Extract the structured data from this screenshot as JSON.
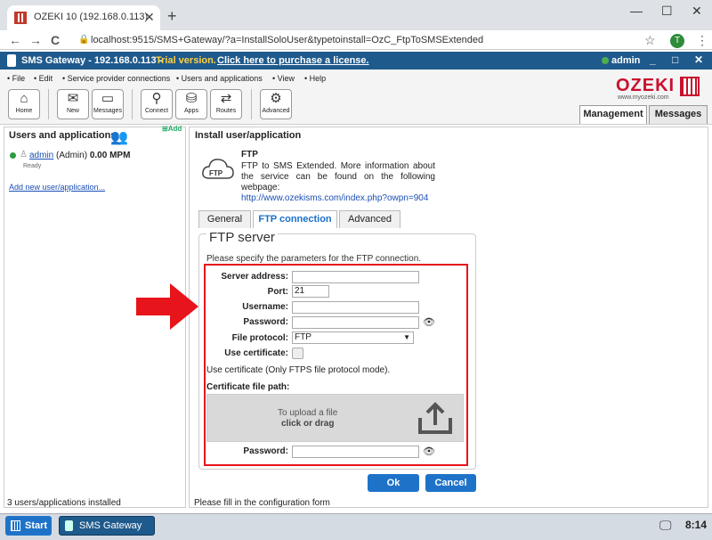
{
  "browser": {
    "tab_title": "OZEKI 10 (192.168.0.113)",
    "tab_close": "✕",
    "new_tab": "+",
    "url": "localhost:9515/SMS+Gateway/?a=InstallSoloUser&typetoinstall=OzC_FtpToSMSExtended",
    "profile_initial": "T",
    "back": "←",
    "forward": "→",
    "reload": "C",
    "minimize": "—",
    "maximize": "☐",
    "close": "✕"
  },
  "app": {
    "title": "SMS Gateway - 192.168.0.113 -",
    "trial": "Trial version.",
    "purchase": "Click here to purchase a license.",
    "user": "admin",
    "brand": "OZEKI",
    "brand_web": "www.myozeki.com"
  },
  "menu": [
    "File",
    "Edit",
    "Service provider connections",
    "Users and applications",
    "View",
    "Help"
  ],
  "toolbar": [
    {
      "label": "Home",
      "icon": "home-icon"
    },
    {
      "label": "New",
      "icon": "new-icon"
    },
    {
      "label": "Messages",
      "icon": "folder-icon"
    },
    {
      "label": "Connect",
      "icon": "antenna-icon"
    },
    {
      "label": "Apps",
      "icon": "database-icon"
    },
    {
      "label": "Routes",
      "icon": "routes-icon"
    },
    {
      "label": "Advanced",
      "icon": "gear-icon"
    }
  ],
  "main_tabs": {
    "management": "Management",
    "messages": "Messages"
  },
  "left": {
    "heading": "Users and applications",
    "add": "Add",
    "user_name": "admin",
    "user_role": "(Admin)",
    "user_rate": "0.00 MPM",
    "user_status": "Ready",
    "add_link": "Add new user/application...",
    "status": "3 users/applications installed"
  },
  "right": {
    "heading": "Install user/application",
    "icon_label": "FTP",
    "app_title": "FTP",
    "description": "FTP to SMS Extended. More information about the service can be found on the following webpage:",
    "link": "http://www.ozekisms.com/index.php?owpn=904",
    "tabs": [
      "General",
      "FTP connection",
      "Advanced"
    ],
    "legend": "FTP server",
    "intro": "Please specify the parameters for the FTP connection.",
    "fields": {
      "server_label": "Server address:",
      "server_value": "",
      "port_label": "Port:",
      "port_value": "21",
      "username_label": "Username:",
      "username_value": "",
      "password_label": "Password:",
      "password_value": "",
      "protocol_label": "File protocol:",
      "protocol_value": "FTP",
      "cert_label": "Use certificate:",
      "cert_note": "Use certificate (Only FTPS file protocol mode).",
      "cert_path_label": "Certificate file path:",
      "upload_line1": "To upload a file",
      "upload_line2": "click or drag",
      "cert_password_label": "Password:",
      "cert_password_value": ""
    },
    "ok": "Ok",
    "cancel": "Cancel",
    "status": "Please fill in the configuration form"
  },
  "taskbar": {
    "start": "Start",
    "task": "SMS Gateway",
    "time": "8:14"
  },
  "colors": {
    "accent": "#1e73c9",
    "titlebar": "#1f5a8c",
    "highlight": "#e8141b",
    "trial": "#ffd23f"
  }
}
